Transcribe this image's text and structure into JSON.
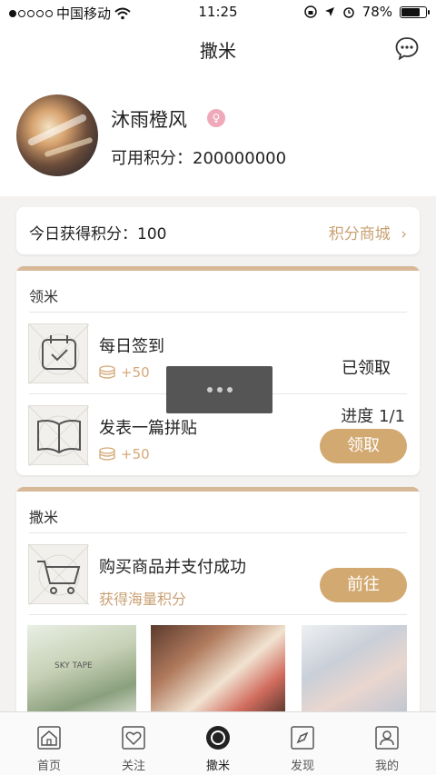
{
  "status_bar": {
    "carrier": "中国移动",
    "time": "11:25",
    "battery": "78%",
    "signal_bars_filled": 1,
    "signal_bars_total": 5
  },
  "nav": {
    "title": "撒米",
    "chat_icon": "chat-bubble-icon"
  },
  "profile": {
    "username": "沐雨橙风",
    "gender_icon": "female-icon",
    "points_label": "可用积分：",
    "points_value": "200000000"
  },
  "today": {
    "label": "今日获得积分：",
    "value": "100",
    "mall_link": "积分商城"
  },
  "lingmi": {
    "heading": "领米",
    "tasks": [
      {
        "title": "每日签到",
        "reward": "+50",
        "status": "已领取",
        "icon": "calendar-check-icon"
      },
      {
        "title": "发表一篇拼贴",
        "reward": "+50",
        "progress": "进度  1/1",
        "button": "领取",
        "icon": "open-book-icon"
      }
    ]
  },
  "sami": {
    "heading": "撒米",
    "tasks": [
      {
        "title": "购买商品并支付成功",
        "subtitle": "获得海量积分",
        "button": "前往",
        "icon": "shopping-cart-icon"
      }
    ]
  },
  "products": [
    {
      "label": "SKY  TAPE"
    },
    {
      "label": ""
    },
    {
      "label": ""
    }
  ],
  "tabs": [
    {
      "label": "首页",
      "icon": "home-icon"
    },
    {
      "label": "关注",
      "icon": "heart-icon"
    },
    {
      "label": "撒米",
      "icon": "coin-circle-icon",
      "active": true
    },
    {
      "label": "发现",
      "icon": "compass-icon"
    },
    {
      "label": "我的",
      "icon": "user-icon"
    }
  ],
  "colors": {
    "accent": "#d3a972",
    "accent_text": "#c9a174",
    "card_topbar": "#d7b897"
  }
}
